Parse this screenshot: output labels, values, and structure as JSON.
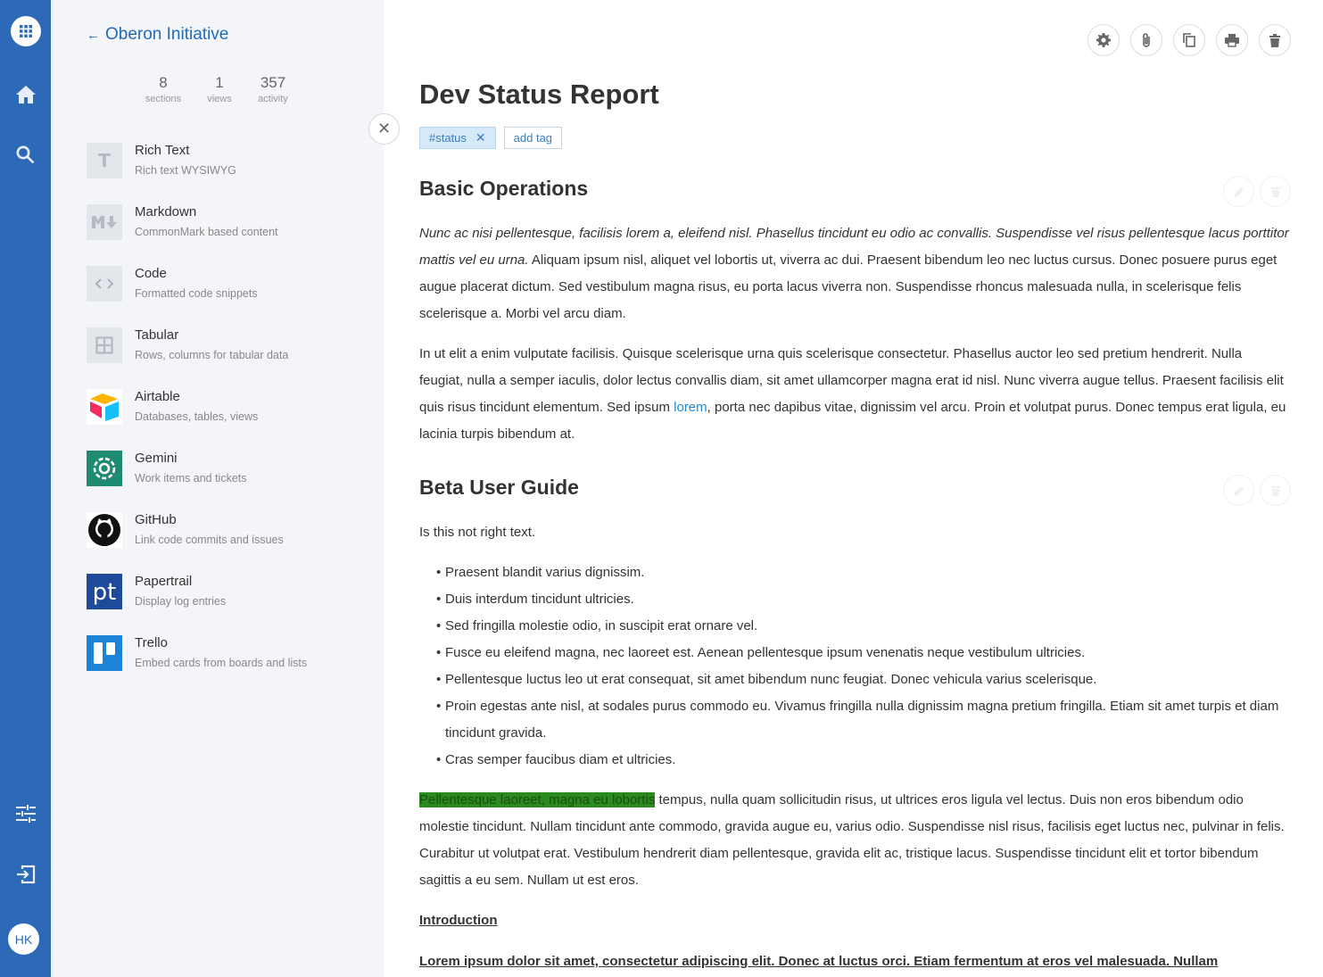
{
  "rail": {
    "avatar_initials": "HK"
  },
  "panel": {
    "back_label": "Oberon Initiative",
    "stats": [
      {
        "value": "8",
        "label": "sections"
      },
      {
        "value": "1",
        "label": "views"
      },
      {
        "value": "357",
        "label": "activity"
      }
    ],
    "sections": [
      {
        "title": "Rich Text",
        "desc": "Rich text WYSIWYG",
        "icon": "rich-text-icon"
      },
      {
        "title": "Markdown",
        "desc": "CommonMark based content",
        "icon": "markdown-icon"
      },
      {
        "title": "Code",
        "desc": "Formatted code snippets",
        "icon": "code-icon"
      },
      {
        "title": "Tabular",
        "desc": "Rows, columns for tabular data",
        "icon": "table-icon"
      },
      {
        "title": "Airtable",
        "desc": "Databases, tables, views",
        "icon": "airtable-logo-icon"
      },
      {
        "title": "Gemini",
        "desc": "Work items and tickets",
        "icon": "gemini-logo-icon"
      },
      {
        "title": "GitHub",
        "desc": "Link code commits and issues",
        "icon": "github-logo-icon"
      },
      {
        "title": "Papertrail",
        "desc": "Display log entries",
        "icon": "papertrail-logo-icon"
      },
      {
        "title": "Trello",
        "desc": "Embed cards from boards and lists",
        "icon": "trello-logo-icon"
      }
    ]
  },
  "doc": {
    "title": "Dev Status Report",
    "tag": "#status",
    "add_tag": "add tag",
    "section1": {
      "heading": "Basic Operations",
      "p1_italic": "Nunc ac nisi pellentesque, facilisis lorem a, eleifend nisl. Phasellus tincidunt eu odio ac convallis. Suspendisse vel risus pellentesque lacus porttitor mattis vel eu urna.",
      "p1_rest": " Aliquam ipsum nisl, aliquet vel lobortis ut, viverra ac dui. Praesent bibendum leo nec luctus cursus. Donec posuere purus eget augue placerat dictum. Sed vestibulum magna risus, eu porta lacus viverra non. Suspendisse rhoncus malesuada nulla, in scelerisque felis scelerisque a. Morbi vel arcu diam.",
      "p2_start": "In ut elit a enim vulputate facilisis. Quisque scelerisque urna quis scelerisque consectetur. Phasellus auctor leo sed pretium hendrerit. Nulla feugiat, nulla a semper iaculis, dolor lectus convallis diam, sit amet ullamcorper magna erat id nisl. Nunc viverra augue tellus. Praesent facilisis elit quis risus tincidunt elementum. Sed ipsum ",
      "p2_link": "lorem",
      "p2_end": ", porta nec dapibus vitae, dignissim vel arcu. Proin et volutpat purus. Donec tempus erat ligula, eu lacinia turpis bibendum at."
    },
    "section2": {
      "heading": "Beta User Guide",
      "intro": "Is this not right text.",
      "bullets": [
        "Praesent blandit varius dignissim.",
        "Duis interdum tincidunt ultricies.",
        "Sed fringilla molestie odio, in suscipit erat ornare vel.",
        "Fusce eu eleifend magna, nec laoreet est. Aenean pellentesque ipsum venenatis neque vestibulum ultricies.",
        "Pellentesque luctus leo ut erat consequat, sit amet bibendum nunc feugiat. Donec vehicula varius scelerisque.",
        "Proin egestas ante nisl, at sodales purus commodo eu. Vivamus fringilla nulla dignissim magna pretium fringilla. Etiam sit amet turpis et diam tincidunt gravida.",
        "Cras semper faucibus diam et ultricies."
      ],
      "p_highlight": "Pellentesque laoreet, magna eu lobortis",
      "p_rest": " tempus, nulla quam sollicitudin risus, ut ultrices eros ligula vel lectus. Duis non eros bibendum odio molestie tincidunt. Nullam tincidunt ante commodo, gravida augue eu, varius odio. Suspendisse nisl risus, facilisis eget luctus nec, pulvinar in felis. Curabitur ut volutpat erat. Vestibulum hendrerit diam pellentesque, gravida elit ac, tristique lacus. Suspendisse tincidunt elit et tortor bibendum sagittis a eu sem. Nullam ut est eros.",
      "intro_heading": "Introduction",
      "last_line": "Lorem ipsum dolor sit amet, consectetur adipiscing elit. Donec at luctus orci. Etiam fermentum at eros vel malesuada. Nullam"
    }
  },
  "colors": {
    "rail": "#2c6ab8",
    "panel": "#f4f5f9",
    "link": "#1f8ad2",
    "highlight": "#2b8a1e"
  }
}
